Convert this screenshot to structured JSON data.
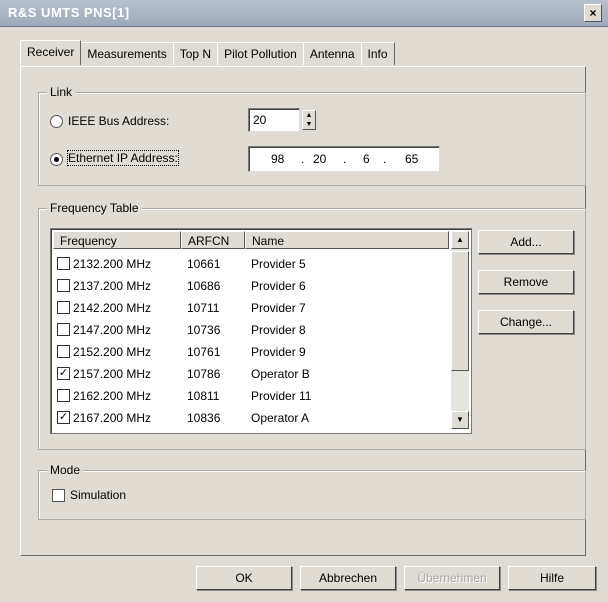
{
  "window": {
    "title": "R&S UMTS PNS[1]",
    "close_glyph": "×"
  },
  "tabs": [
    "Receiver",
    "Measurements",
    "Top N",
    "Pilot Pollution",
    "Antenna",
    "Info"
  ],
  "link": {
    "group_label": "Link",
    "ieee_label": "IEEE Bus Address:",
    "ieee_value": "20",
    "ethernet_label": "Ethernet IP Address:",
    "ip": [
      "98",
      "20",
      "6",
      "65"
    ],
    "selected": "ethernet"
  },
  "frequency_table": {
    "group_label": "Frequency Table",
    "columns": [
      "Frequency",
      "ARFCN",
      "Name"
    ],
    "rows": [
      {
        "frequency": "2132.200 MHz",
        "arfcn": "10661",
        "name": "Provider 5",
        "checked": false
      },
      {
        "frequency": "2137.200 MHz",
        "arfcn": "10686",
        "name": "Provider 6",
        "checked": false
      },
      {
        "frequency": "2142.200 MHz",
        "arfcn": "10711",
        "name": "Provider 7",
        "checked": false
      },
      {
        "frequency": "2147.200 MHz",
        "arfcn": "10736",
        "name": "Provider 8",
        "checked": false
      },
      {
        "frequency": "2152.200 MHz",
        "arfcn": "10761",
        "name": "Provider 9",
        "checked": false
      },
      {
        "frequency": "2157.200 MHz",
        "arfcn": "10786",
        "name": "Operator B",
        "checked": true
      },
      {
        "frequency": "2162.200 MHz",
        "arfcn": "10811",
        "name": "Provider 11",
        "checked": false
      },
      {
        "frequency": "2167.200 MHz",
        "arfcn": "10836",
        "name": "Operator A",
        "checked": true
      }
    ],
    "buttons": {
      "add": "Add...",
      "remove": "Remove",
      "change": "Change..."
    }
  },
  "mode": {
    "group_label": "Mode",
    "simulation_label": "Simulation",
    "simulation_checked": false
  },
  "footer": {
    "ok": "OK",
    "cancel": "Abbrechen",
    "apply": "Übernehmen",
    "help": "Hilfe"
  }
}
